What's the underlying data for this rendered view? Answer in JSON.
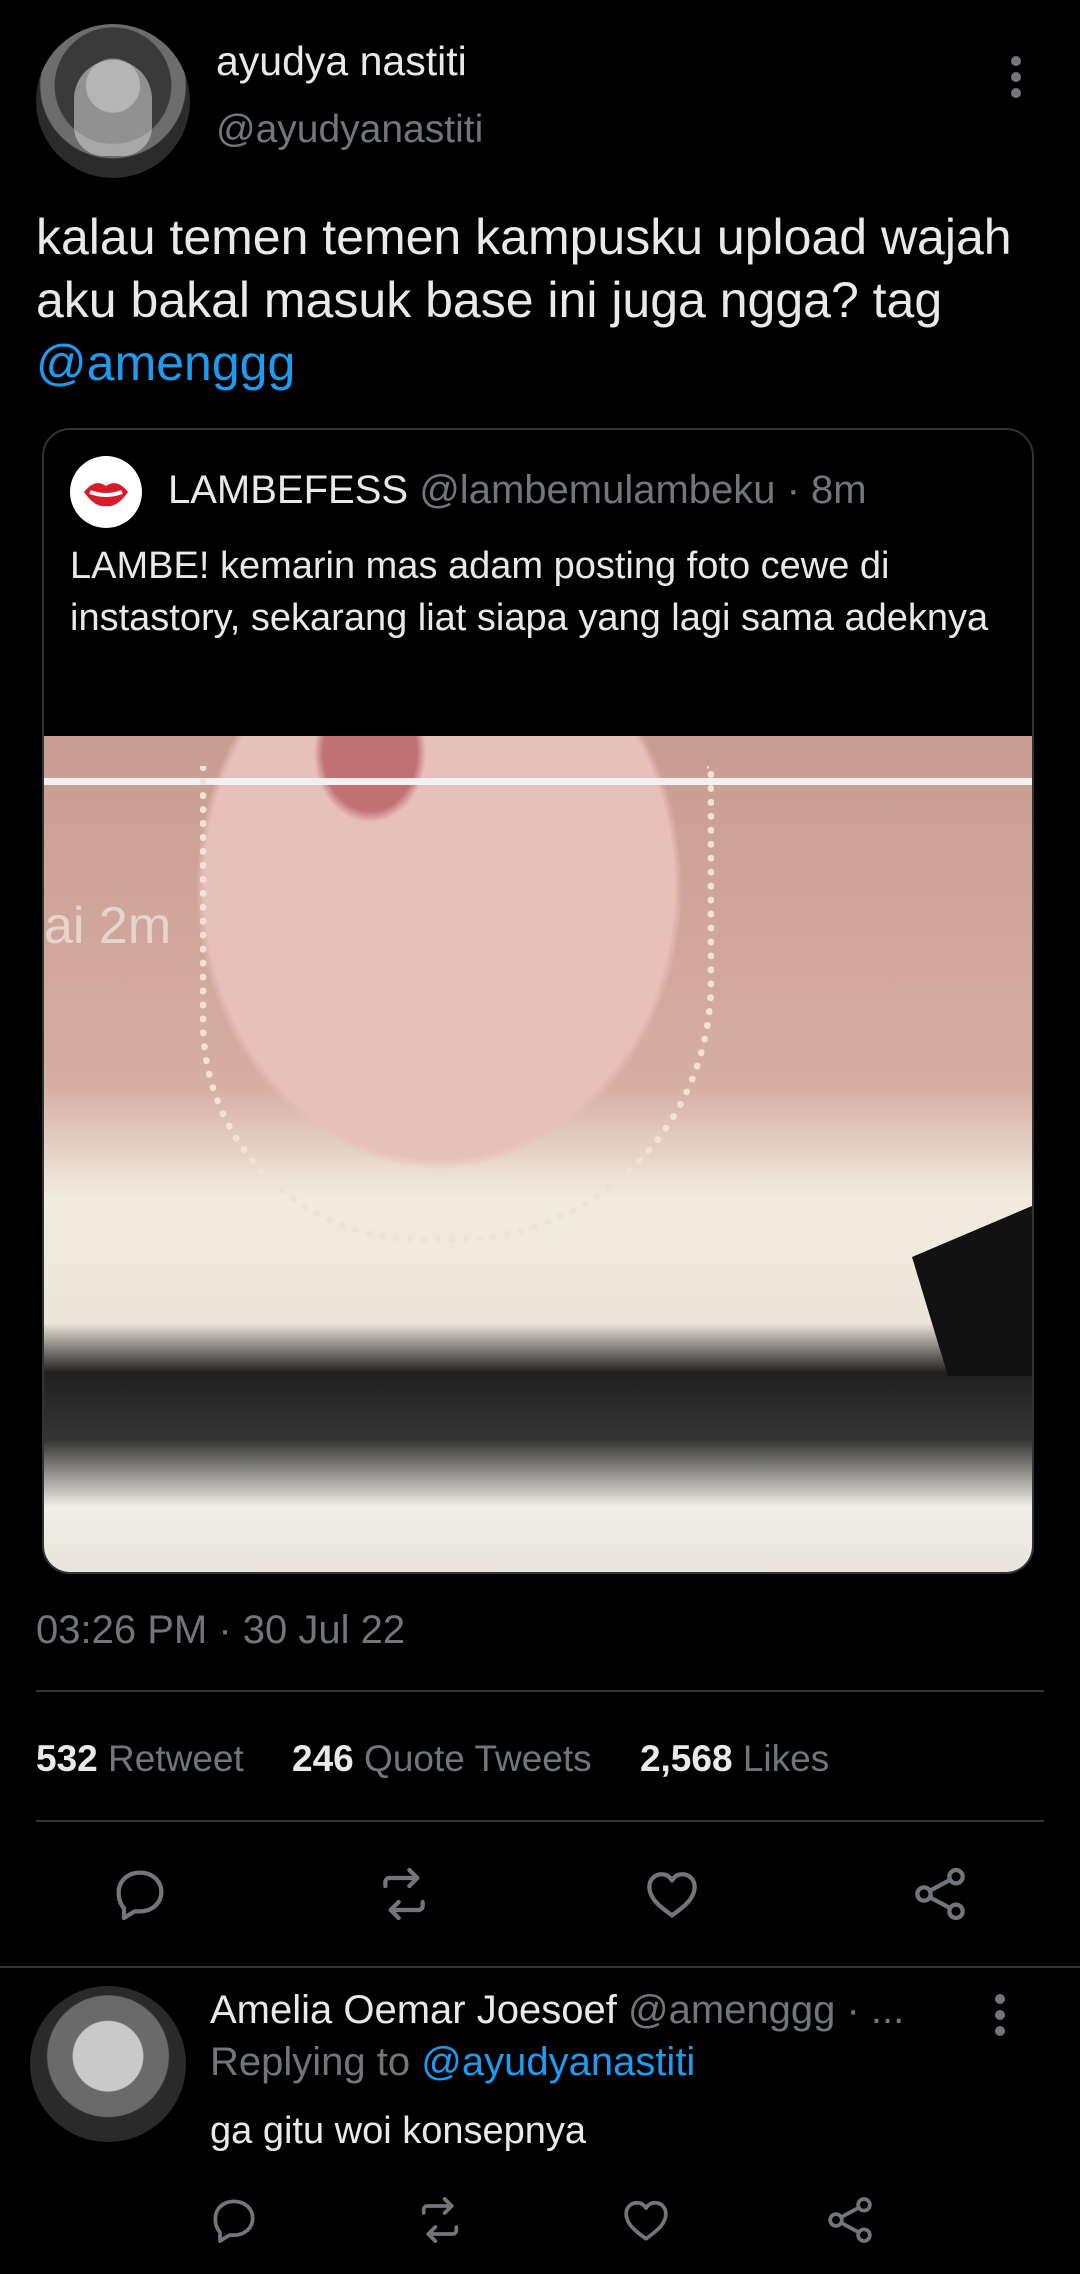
{
  "author": {
    "name": "ayudya nastiti",
    "handle": "@ayudyanastiti"
  },
  "tweet": {
    "text": "kalau temen temen kampusku upload wajah aku bakal masuk base ini juga ngga? tag ",
    "mention": "@amenggg",
    "timestamp": "03:26 PM · 30 Jul 22"
  },
  "quote": {
    "name": "LAMBEFESS",
    "handle": "@lambemulambeku · 8m",
    "text": "LAMBE! kemarin mas adam posting foto cewe di instastory, sekarang liat siapa yang lagi sama adeknya",
    "image_overlay_text": "ai  2m"
  },
  "stats": {
    "retweets": "532",
    "retweets_label": "Retweet",
    "quotes": "246",
    "quotes_label": "Quote Tweets",
    "likes": "2,568",
    "likes_label": "Likes"
  },
  "reply": {
    "name": "Amelia Oemar Joesoef",
    "handle": "@amenggg · ...",
    "replying_label": "Replying to ",
    "replying_handle": "@ayudyanastiti",
    "text": "ga gitu woi konsepnya"
  },
  "icons": [
    "reply-icon",
    "retweet-icon",
    "like-icon",
    "share-icon",
    "more-icon"
  ],
  "colors": {
    "background": "#000000",
    "text": "#e7e9ea",
    "muted": "#71767b",
    "accent": "#1d9bf0",
    "border": "#2f3336"
  }
}
